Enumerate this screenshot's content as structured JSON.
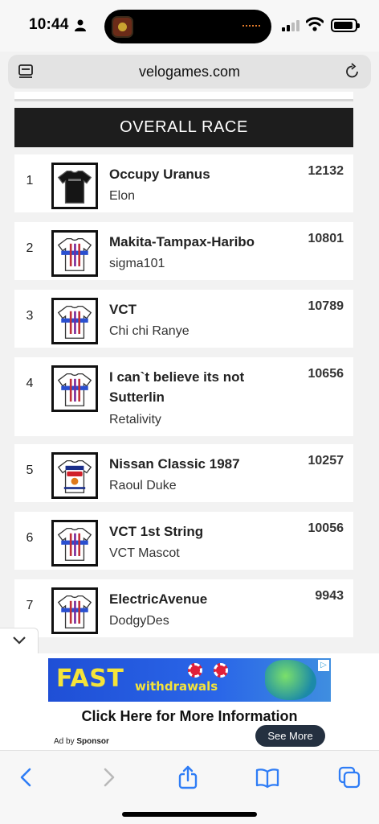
{
  "status_bar": {
    "time": "10:44"
  },
  "browser": {
    "url": "velogames.com"
  },
  "leaderboard": {
    "title": "OVERALL RACE",
    "rows": [
      {
        "rank": "1",
        "team": "Occupy Uranus",
        "user": "Elon",
        "points": "12132",
        "jersey": "black"
      },
      {
        "rank": "2",
        "team": "Makita-Tampax-Haribo",
        "user": "sigma101",
        "points": "10801",
        "jersey": "white"
      },
      {
        "rank": "3",
        "team": "VCT",
        "user": "Chi chi Ranye",
        "points": "10789",
        "jersey": "white"
      },
      {
        "rank": "4",
        "team": "I can`t believe its not Sutterlin",
        "user": "Retalivity",
        "points": "10656",
        "jersey": "white"
      },
      {
        "rank": "5",
        "team": "Nissan Classic 1987",
        "user": "Raoul Duke",
        "points": "10257",
        "jersey": "classic"
      },
      {
        "rank": "6",
        "team": "VCT 1st String",
        "user": "VCT Mascot",
        "points": "10056",
        "jersey": "white"
      },
      {
        "rank": "7",
        "team": "ElectricAvenue",
        "user": "DodgyDes",
        "points": "9943",
        "jersey": "white"
      }
    ]
  },
  "ad": {
    "banner_big": "FAST",
    "banner_small": "withdrawals",
    "cta": "Click Here for More Information",
    "ad_by_prefix": "Ad by",
    "ad_by_name": "Sponsor",
    "see_more": "See More"
  },
  "colors": {
    "header_bg": "#1d1d1d",
    "ad_blue": "#2a66e8",
    "ad_yellow": "#f5e43a",
    "toolbar_blue": "#2f7df6"
  },
  "icons": [
    "person-icon",
    "signal-icon",
    "wifi-icon",
    "battery-icon",
    "tabs-overview-icon",
    "reload-icon",
    "chevron-down-icon",
    "back-icon",
    "forward-icon",
    "share-icon",
    "bookmarks-icon",
    "tabs-icon"
  ]
}
